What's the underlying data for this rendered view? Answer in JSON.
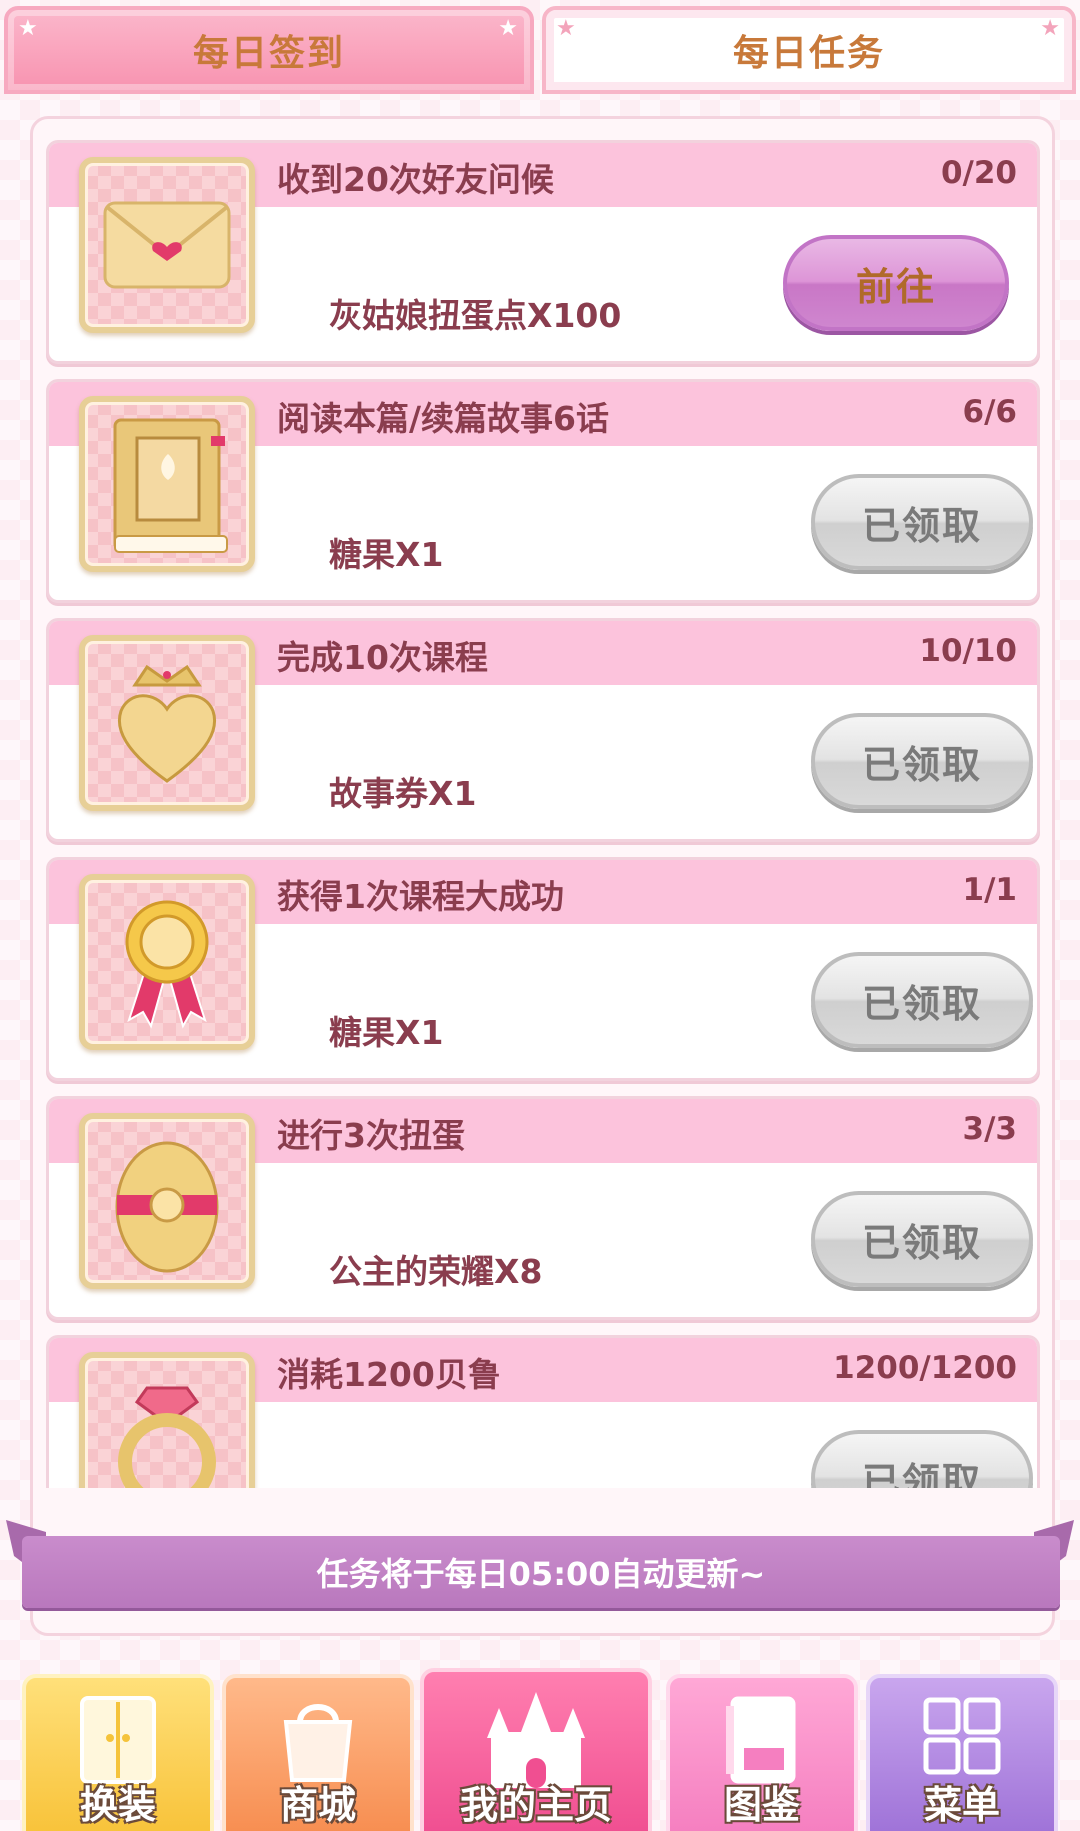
{
  "tabs": [
    {
      "label": "每日签到",
      "active": false
    },
    {
      "label": "每日任务",
      "active": true
    }
  ],
  "tasks": [
    {
      "title": "收到20次好友问候",
      "progress": "0/20",
      "reward": "灰姑娘扭蛋点X100",
      "button": "前往",
      "icon": "envelope-heart-icon"
    },
    {
      "title": "阅读本篇/续篇故事6话",
      "progress": "6/6",
      "reward": "糖果X1",
      "button": "已领取",
      "icon": "storybook-icon"
    },
    {
      "title": "完成10次课程",
      "progress": "10/10",
      "reward": "故事券X1",
      "button": "已领取",
      "icon": "crowned-heart-icon"
    },
    {
      "title": "获得1次课程大成功",
      "progress": "1/1",
      "reward": "糖果X1",
      "button": "已领取",
      "icon": "medal-ribbon-icon"
    },
    {
      "title": "进行3次扭蛋",
      "progress": "3/3",
      "reward": "公主的荣耀X8",
      "button": "已领取",
      "icon": "golden-egg-icon"
    },
    {
      "title": "消耗1200贝鲁",
      "progress": "1200/1200",
      "reward": "",
      "button": "已领取",
      "icon": "gem-ring-icon"
    }
  ],
  "notice": "任务将于每日05:00自动更新~",
  "nav": [
    {
      "label": "换装",
      "icon": "wardrobe-icon"
    },
    {
      "label": "商城",
      "icon": "shopping-bag-icon"
    },
    {
      "label": "我的主页",
      "icon": "castle-icon"
    },
    {
      "label": "图鉴",
      "icon": "album-icon"
    },
    {
      "label": "菜单",
      "icon": "grid-menu-icon"
    }
  ],
  "colors": {
    "accent_pink": "#fcc3dc",
    "go_button": "#dd95d7",
    "done_button": "#d9d9d9",
    "text_brown": "#8a3d4e",
    "notice_purple": "#b978bd"
  }
}
